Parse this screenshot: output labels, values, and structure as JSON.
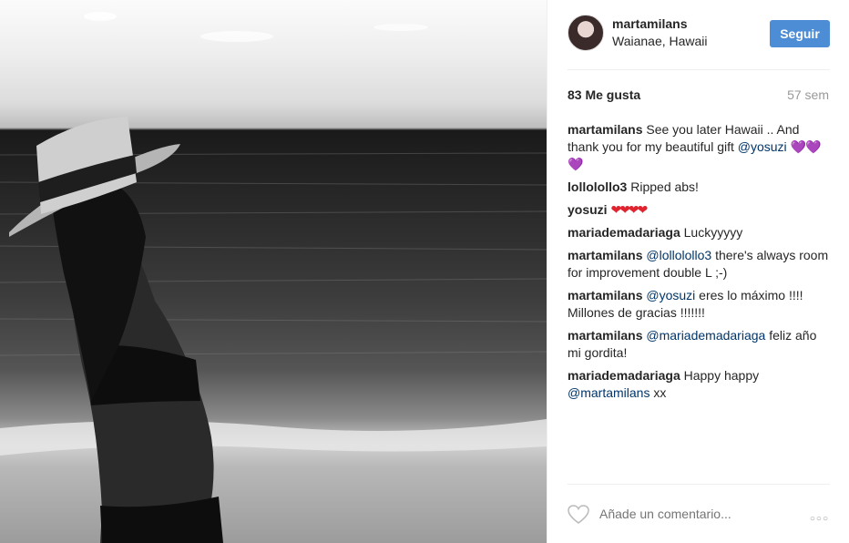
{
  "post": {
    "username": "martamilans",
    "location": "Waianae, Hawaii",
    "follow_label": "Seguir",
    "likes": "83 Me gusta",
    "age": "57 sem"
  },
  "comments": [
    {
      "user": "martamilans",
      "parts": [
        "See you later Hawaii .. And thank you for my beautiful gift ",
        "@yosuzi",
        " ",
        "💜💜💜"
      ]
    },
    {
      "user": "lollolollo3",
      "text": "Ripped abs!"
    },
    {
      "user": "yosuzi",
      "hearts": "❤❤❤❤"
    },
    {
      "user": "mariademadariaga",
      "text": "Luckyyyyy"
    },
    {
      "user": "martamilans",
      "parts": [
        "@lollolollo3",
        " there's always room for improvement double L ;-)"
      ]
    },
    {
      "user": "martamilans",
      "parts": [
        "@yosuzi",
        " eres lo máximo !!!! Millones de gracias !!!!!!!"
      ]
    },
    {
      "user": "martamilans",
      "parts": [
        "@mariademadariaga",
        " feliz año mi gordita!"
      ]
    },
    {
      "user": "mariademadariaga",
      "parts": [
        "Happy happy ",
        "@martamilans",
        " xx"
      ]
    }
  ],
  "footer": {
    "comment_placeholder": "Añade un comentario...",
    "like_icon": "heart-outline-icon",
    "more_icon": "more-options-icon"
  },
  "colors": {
    "follow_button": "#4c8dd6",
    "mention": "#003569",
    "muted": "#999999"
  }
}
